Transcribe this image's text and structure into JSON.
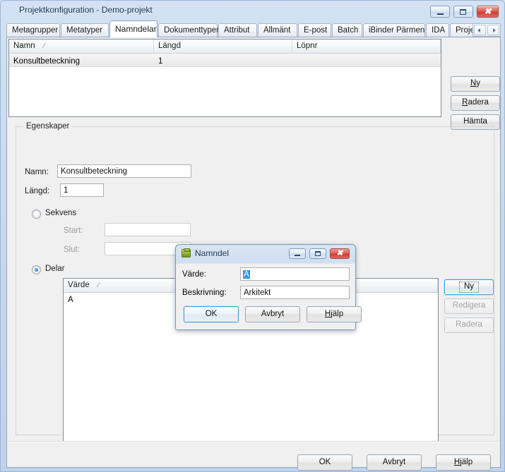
{
  "window": {
    "title": "Projektkonfiguration - Demo-projekt",
    "minimize_icon": "minimize-icon",
    "maximize_icon": "maximize-icon",
    "close_icon": "close-icon"
  },
  "tabs": [
    {
      "label": "Metagrupper",
      "active": false
    },
    {
      "label": "Metatyper",
      "active": false
    },
    {
      "label": "Namndelar",
      "active": true
    },
    {
      "label": "Dokumenttyper",
      "active": false
    },
    {
      "label": "Attribut",
      "active": false
    },
    {
      "label": "Allmänt",
      "active": false
    },
    {
      "label": "E-post",
      "active": false
    },
    {
      "label": "Batch",
      "active": false
    },
    {
      "label": "iBinder Pärmen",
      "active": false
    },
    {
      "label": "IDA",
      "active": false
    },
    {
      "label": "ProjectWise",
      "active": false
    }
  ],
  "tab_nav": {
    "left_icon": "chevron-left-icon",
    "right_icon": "chevron-right-icon"
  },
  "top_list": {
    "columns": [
      {
        "label": "Namn",
        "sort": "∕"
      },
      {
        "label": "Längd",
        "sort": ""
      },
      {
        "label": "Löpnr",
        "sort": ""
      }
    ],
    "rows": [
      {
        "namn": "Konsultbeteckning",
        "langd": "1",
        "lopnr": "",
        "selected": true
      }
    ]
  },
  "top_buttons": [
    {
      "label": "Ny",
      "mnemonic": "N",
      "enabled": true
    },
    {
      "label": "Radera",
      "mnemonic": "R",
      "enabled": true
    },
    {
      "label": "Hämta",
      "mnemonic": "",
      "enabled": true
    }
  ],
  "properties": {
    "legend": "Egenskaper",
    "namn_label": "Namn:",
    "namn_value": "Konsultbeteckning",
    "langd_label": "Längd:",
    "langd_value": "1",
    "sekvens_label": "Sekvens",
    "sekvens_selected": false,
    "start_label": "Start:",
    "start_value": "",
    "slut_label": "Slut:",
    "slut_value": "",
    "delar_label": "Delar",
    "delar_selected": true
  },
  "bottom_list": {
    "columns": [
      {
        "label": "Värde",
        "sort": "∕"
      }
    ],
    "rows": [
      {
        "varde": "A"
      }
    ]
  },
  "bottom_buttons": [
    {
      "label": "Ny",
      "enabled": true,
      "focused": true
    },
    {
      "label": "Redigera",
      "enabled": false,
      "focused": false
    },
    {
      "label": "Radera",
      "enabled": false,
      "focused": false
    }
  ],
  "footer_buttons": [
    {
      "label": "OK",
      "mnemonic": ""
    },
    {
      "label": "Avbryt",
      "mnemonic": ""
    },
    {
      "label": "Hjälp",
      "mnemonic": "H"
    }
  ],
  "dialog": {
    "title": "Namndel",
    "icon": "box-icon",
    "minimize_icon": "minimize-icon",
    "maximize_icon": "maximize-icon",
    "close_icon": "close-icon",
    "varde_label": "Värde:",
    "varde_value": "A",
    "varde_selected": true,
    "beskrivning_label": "Beskrivning:",
    "beskrivning_value": "Arkitekt",
    "ok_label": "OK",
    "cancel_label": "Avbryt",
    "help_label": "Hjälp",
    "help_mnemonic": "H"
  },
  "colors": {
    "window_frame": "#9bb6d4",
    "titlebar_start": "#d3e1f3",
    "titlebar_end": "#bfd2ea",
    "client_bg": "#f0f0f0",
    "close_button": "#cf3d34",
    "selection_blue": "#3399dd",
    "focus_blue": "#3f9ecb",
    "radio_dot": "#2a7fc0",
    "dialog_icon_green": "#9db93b"
  }
}
